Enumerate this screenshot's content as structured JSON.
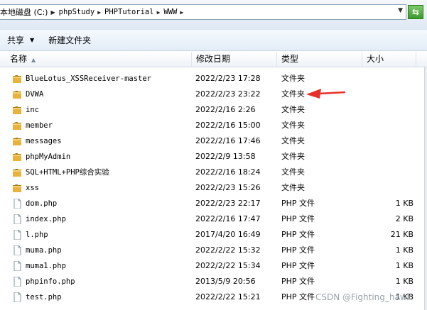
{
  "address": {
    "crumbs": [
      "本地磁盘 (C:)",
      "phpStudy",
      "PHPTutorial",
      "WWW"
    ],
    "refresh_icon": "refresh-go-icon"
  },
  "toolbar": {
    "share_label": "共享",
    "new_folder_label": "新建文件夹"
  },
  "columns": {
    "name": "名称",
    "date": "修改日期",
    "type": "类型",
    "size": "大小"
  },
  "files": [
    {
      "name": "BlueLotus_XSSReceiver-master",
      "date": "2022/2/23 17:28",
      "type": "文件夹",
      "size": "",
      "kind": "folder"
    },
    {
      "name": "DVWA",
      "date": "2022/2/23 23:22",
      "type": "文件夹",
      "size": "",
      "kind": "folder"
    },
    {
      "name": "inc",
      "date": "2022/2/16 2:26",
      "type": "文件夹",
      "size": "",
      "kind": "folder"
    },
    {
      "name": "member",
      "date": "2022/2/16 15:00",
      "type": "文件夹",
      "size": "",
      "kind": "folder"
    },
    {
      "name": "messages",
      "date": "2022/2/16 17:46",
      "type": "文件夹",
      "size": "",
      "kind": "folder"
    },
    {
      "name": "phpMyAdmin",
      "date": "2022/2/9 13:58",
      "type": "文件夹",
      "size": "",
      "kind": "folder"
    },
    {
      "name": "SQL+HTML+PHP综合实验",
      "date": "2022/2/16 18:24",
      "type": "文件夹",
      "size": "",
      "kind": "folder"
    },
    {
      "name": "xss",
      "date": "2022/2/23 15:26",
      "type": "文件夹",
      "size": "",
      "kind": "folder"
    },
    {
      "name": "dom.php",
      "date": "2022/2/23 22:17",
      "type": "PHP 文件",
      "size": "1 KB",
      "kind": "file"
    },
    {
      "name": "index.php",
      "date": "2022/2/16 17:47",
      "type": "PHP 文件",
      "size": "2 KB",
      "kind": "file"
    },
    {
      "name": "l.php",
      "date": "2017/4/20 16:49",
      "type": "PHP 文件",
      "size": "21 KB",
      "kind": "file"
    },
    {
      "name": "muma.php",
      "date": "2022/2/22 15:32",
      "type": "PHP 文件",
      "size": "1 KB",
      "kind": "file"
    },
    {
      "name": "muma1.php",
      "date": "2022/2/22 15:34",
      "type": "PHP 文件",
      "size": "1 KB",
      "kind": "file"
    },
    {
      "name": "phpinfo.php",
      "date": "2013/5/9 20:56",
      "type": "PHP 文件",
      "size": "1 KB",
      "kind": "file"
    },
    {
      "name": "test.php",
      "date": "2022/2/22 15:21",
      "type": "PHP 文件",
      "size": "1 KB",
      "kind": "file"
    }
  ],
  "watermark": "CSDN @Fighting_hawk",
  "colors": {
    "folder": "#e8b33c",
    "annotation": "#e8302a"
  }
}
